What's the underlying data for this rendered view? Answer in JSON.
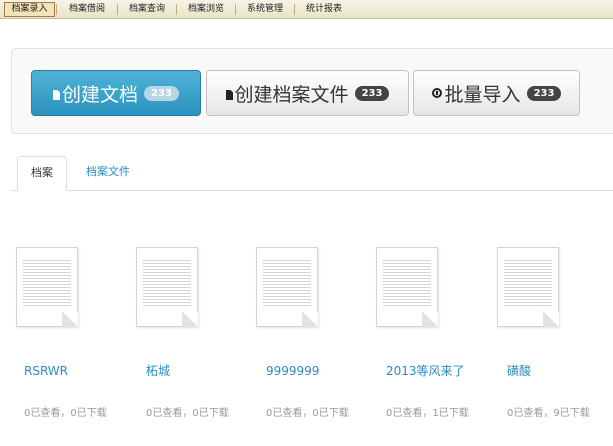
{
  "menu": {
    "items": [
      {
        "label": "档案录入",
        "active": true
      },
      {
        "label": "档案借阅"
      },
      {
        "label": "档案查询"
      },
      {
        "label": "档案浏览"
      },
      {
        "label": "系统管理"
      },
      {
        "label": "统计报表"
      }
    ]
  },
  "actions": {
    "create_doc": {
      "label": "创建文档",
      "badge": "233",
      "icon": "file-icon"
    },
    "create_archive_file": {
      "label": "创建档案文件",
      "badge": "233",
      "icon": "file-icon"
    },
    "batch_import": {
      "label": "批量导入",
      "badge": "233",
      "icon": "circle-arrow-icon"
    }
  },
  "tabs": [
    {
      "label": "档案",
      "active": true
    },
    {
      "label": "档案文件"
    }
  ],
  "files": [
    {
      "name": "RSRWR",
      "stats": "0已查看，0已下载"
    },
    {
      "name": "柘城",
      "stats": "0已查看，0已下载"
    },
    {
      "name": "9999999",
      "stats": "0已查看，0已下载"
    },
    {
      "name": "2013等风来了",
      "stats": "0已查看，1已下载"
    },
    {
      "name": "磺酸",
      "stats": "0已查看，9已下载"
    }
  ],
  "colors": {
    "primary": "#2c93bf",
    "link": "#2b8cc4",
    "menu_bg": "#efe9d2"
  }
}
